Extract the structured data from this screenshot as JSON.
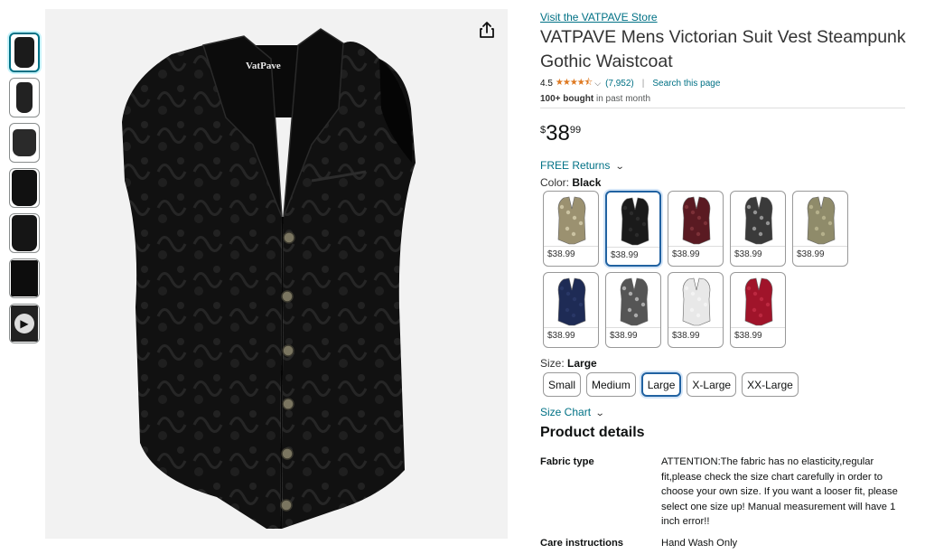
{
  "store": {
    "link_text": "Visit the VATPAVE Store"
  },
  "product": {
    "title": "VATPAVE Mens Victorian Suit Vest Steampunk Gothic Waistcoat",
    "rating": "4.5",
    "stars": "★★★★⯪",
    "reviews": "(7,952)",
    "search_link": "Search this page",
    "bought_bold": "100+ bought",
    "bought_rest": " in past month",
    "brand_label": "VatPave"
  },
  "price": {
    "symbol": "$",
    "whole": "38",
    "fraction": "99"
  },
  "returns": {
    "label": "FREE Returns"
  },
  "color": {
    "label": "Color: ",
    "selected": "Black",
    "options": [
      {
        "name": "Gold Paisley",
        "price": "$38.99",
        "fill": "#9b9170",
        "pattern": "#e0d8b8"
      },
      {
        "name": "Black",
        "price": "$38.99",
        "fill": "#1a1a1a",
        "pattern": "#333333"
      },
      {
        "name": "Wine Red",
        "price": "$38.99",
        "fill": "#5a1a22",
        "pattern": "#8a3a40"
      },
      {
        "name": "Gray Paisley",
        "price": "$38.99",
        "fill": "#3a3a3a",
        "pattern": "#b8b8b8"
      },
      {
        "name": "Khaki",
        "price": "$38.99",
        "fill": "#8f8b6a",
        "pattern": "#c4c09a"
      },
      {
        "name": "Navy",
        "price": "$38.99",
        "fill": "#1e2b55",
        "pattern": "#2e3d6e"
      },
      {
        "name": "Silver Paisley",
        "price": "$38.99",
        "fill": "#555555",
        "pattern": "#d0d0d0"
      },
      {
        "name": "White",
        "price": "$38.99",
        "fill": "#e8e8e8",
        "pattern": "#f8f8f8"
      },
      {
        "name": "Red",
        "price": "$38.99",
        "fill": "#a0142a",
        "pattern": "#c8304a"
      }
    ]
  },
  "size": {
    "label": "Size: ",
    "selected": "Large",
    "options": [
      "Small",
      "Medium",
      "Large",
      "X-Large",
      "XX-Large"
    ],
    "chart_link": "Size Chart"
  },
  "details": {
    "title": "Product details",
    "rows": [
      {
        "key": "Fabric type",
        "value": "ATTENTION:The fabric has no elasticity,regular fit,please check the size chart carefully in order to choose your own size. If you want a looser fit, please select one size up! Manual measurement will have 1 inch error!!"
      },
      {
        "key": "Care instructions",
        "value": "Hand Wash Only"
      }
    ]
  },
  "icons": {
    "share": "share-icon",
    "play": "play-icon",
    "chevron": "chevron-down-icon"
  }
}
